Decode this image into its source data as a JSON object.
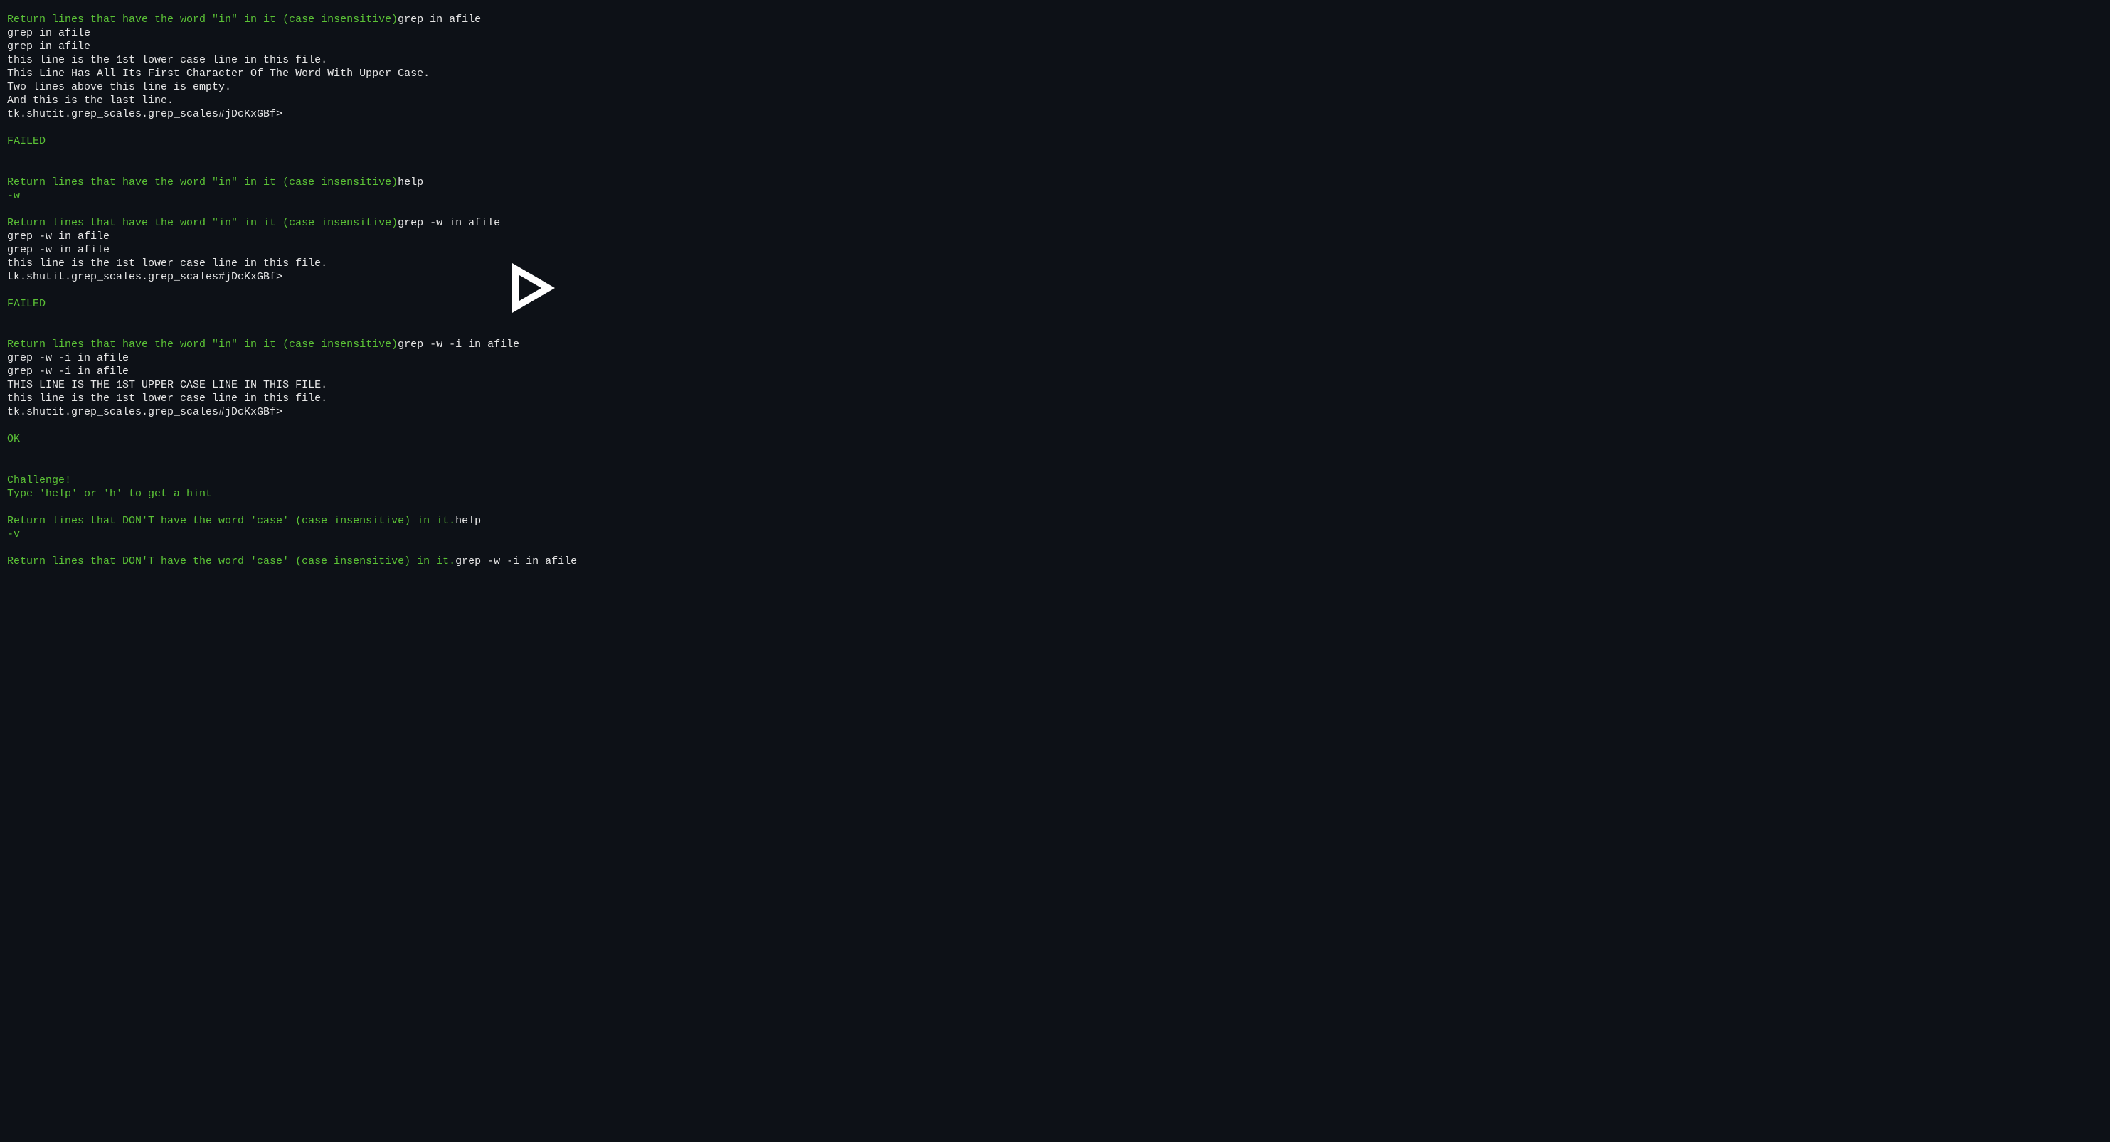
{
  "lines": [
    {
      "segments": [
        {
          "class": "green",
          "text": "Return lines that have the word \"in\" in it (case insensitive)"
        },
        {
          "class": "white",
          "text": "grep in afile"
        }
      ]
    },
    {
      "segments": [
        {
          "class": "white",
          "text": "grep in afile"
        }
      ]
    },
    {
      "segments": [
        {
          "class": "white",
          "text": "grep in afile"
        }
      ]
    },
    {
      "segments": [
        {
          "class": "white",
          "text": "this line is the 1st lower case line in this file."
        }
      ]
    },
    {
      "segments": [
        {
          "class": "white",
          "text": "This Line Has All Its First Character Of The Word With Upper Case."
        }
      ]
    },
    {
      "segments": [
        {
          "class": "white",
          "text": "Two lines above this line is empty."
        }
      ]
    },
    {
      "segments": [
        {
          "class": "white",
          "text": "And this is the last line."
        }
      ]
    },
    {
      "segments": [
        {
          "class": "white",
          "text": "tk.shutit.grep_scales.grep_scales#jDcKxGBf>"
        }
      ]
    },
    {
      "segments": [
        {
          "class": "white",
          "text": ""
        }
      ]
    },
    {
      "segments": [
        {
          "class": "green",
          "text": "FAILED"
        }
      ]
    },
    {
      "segments": [
        {
          "class": "white",
          "text": ""
        }
      ]
    },
    {
      "segments": [
        {
          "class": "white",
          "text": ""
        }
      ]
    },
    {
      "segments": [
        {
          "class": "green",
          "text": "Return lines that have the word \"in\" in it (case insensitive)"
        },
        {
          "class": "white",
          "text": "help"
        }
      ]
    },
    {
      "segments": [
        {
          "class": "green",
          "text": "-w"
        }
      ]
    },
    {
      "segments": [
        {
          "class": "white",
          "text": ""
        }
      ]
    },
    {
      "segments": [
        {
          "class": "green",
          "text": "Return lines that have the word \"in\" in it (case insensitive)"
        },
        {
          "class": "white",
          "text": "grep -w in afile"
        }
      ]
    },
    {
      "segments": [
        {
          "class": "white",
          "text": "grep -w in afile"
        }
      ]
    },
    {
      "segments": [
        {
          "class": "white",
          "text": "grep -w in afile"
        }
      ]
    },
    {
      "segments": [
        {
          "class": "white",
          "text": "this line is the 1st lower case line in this file."
        }
      ]
    },
    {
      "segments": [
        {
          "class": "white",
          "text": "tk.shutit.grep_scales.grep_scales#jDcKxGBf>"
        }
      ]
    },
    {
      "segments": [
        {
          "class": "white",
          "text": ""
        }
      ]
    },
    {
      "segments": [
        {
          "class": "green",
          "text": "FAILED"
        }
      ]
    },
    {
      "segments": [
        {
          "class": "white",
          "text": ""
        }
      ]
    },
    {
      "segments": [
        {
          "class": "white",
          "text": ""
        }
      ]
    },
    {
      "segments": [
        {
          "class": "green",
          "text": "Return lines that have the word \"in\" in it (case insensitive)"
        },
        {
          "class": "white",
          "text": "grep -w -i in afile"
        }
      ]
    },
    {
      "segments": [
        {
          "class": "white",
          "text": "grep -w -i in afile"
        }
      ]
    },
    {
      "segments": [
        {
          "class": "white",
          "text": "grep -w -i in afile"
        }
      ]
    },
    {
      "segments": [
        {
          "class": "white",
          "text": "THIS LINE IS THE 1ST UPPER CASE LINE IN THIS FILE."
        }
      ]
    },
    {
      "segments": [
        {
          "class": "white",
          "text": "this line is the 1st lower case line in this file."
        }
      ]
    },
    {
      "segments": [
        {
          "class": "white",
          "text": "tk.shutit.grep_scales.grep_scales#jDcKxGBf>"
        }
      ]
    },
    {
      "segments": [
        {
          "class": "white",
          "text": ""
        }
      ]
    },
    {
      "segments": [
        {
          "class": "green",
          "text": "OK"
        }
      ]
    },
    {
      "segments": [
        {
          "class": "white",
          "text": ""
        }
      ]
    },
    {
      "segments": [
        {
          "class": "white",
          "text": ""
        }
      ]
    },
    {
      "segments": [
        {
          "class": "green",
          "text": "Challenge!"
        }
      ]
    },
    {
      "segments": [
        {
          "class": "green",
          "text": "Type 'help' or 'h' to get a hint"
        }
      ]
    },
    {
      "segments": [
        {
          "class": "white",
          "text": ""
        }
      ]
    },
    {
      "segments": [
        {
          "class": "green",
          "text": "Return lines that DON'T have the word 'case' (case insensitive) in it."
        },
        {
          "class": "white",
          "text": "help"
        }
      ]
    },
    {
      "segments": [
        {
          "class": "green",
          "text": "-v"
        }
      ]
    },
    {
      "segments": [
        {
          "class": "white",
          "text": ""
        }
      ]
    },
    {
      "segments": [
        {
          "class": "green",
          "text": "Return lines that DON'T have the word 'case' (case insensitive) in it."
        },
        {
          "class": "white",
          "text": "grep -w -i in afile"
        }
      ]
    }
  ]
}
